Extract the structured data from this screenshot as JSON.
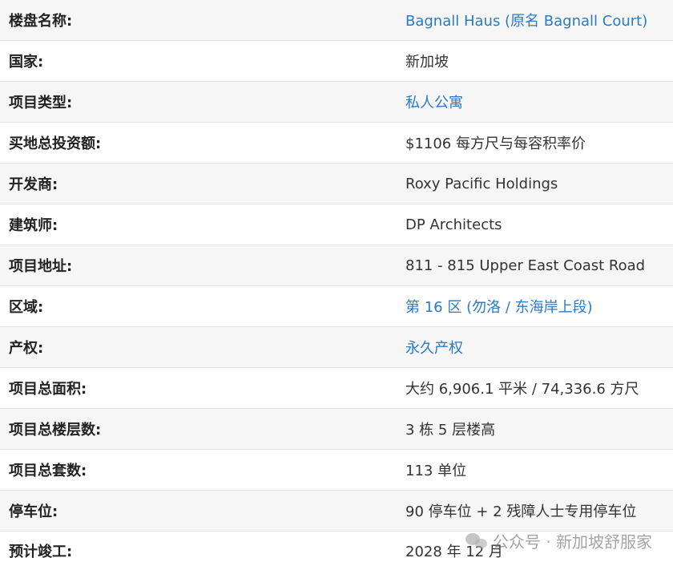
{
  "rows": [
    {
      "label": "楼盘名称:",
      "value": "Bagnall Haus (原名 Bagnall Court)",
      "link": true
    },
    {
      "label": "国家:",
      "value": "新加坡",
      "link": false
    },
    {
      "label": "项目类型:",
      "value": "私人公寓",
      "link": true
    },
    {
      "label": "买地总投资额:",
      "value": "$1106 每方尺与每容积率价",
      "link": false
    },
    {
      "label": "开发商:",
      "value": "Roxy Pacific Holdings",
      "link": false
    },
    {
      "label": "建筑师:",
      "value": "DP Architects",
      "link": false
    },
    {
      "label": "项目地址:",
      "value": "811 - 815 Upper East Coast Road",
      "link": false
    },
    {
      "label": "区域:",
      "value": "第 16 区 (勿洛 / 东海岸上段)",
      "link": true
    },
    {
      "label": "产权:",
      "value": "永久产权",
      "link": true
    },
    {
      "label": "项目总面积:",
      "value": "大约 6,906.1 平米 / 74,336.6 方尺",
      "link": false
    },
    {
      "label": "项目总楼层数:",
      "value": "3 栋 5 层楼高",
      "link": false
    },
    {
      "label": "项目总套数:",
      "value": "113 单位",
      "link": false
    },
    {
      "label": "停车位:",
      "value": "90 停车位 + 2 残障人士专用停车位",
      "link": false
    },
    {
      "label": "预计竣工:",
      "value": "2028 年 12 月",
      "link": false
    }
  ],
  "watermark": {
    "text": "公众号 · 新加坡舒服家",
    "icon": "wechat-icon"
  },
  "colors": {
    "link": "#2a7ac6",
    "stripe": "#f6f6f6",
    "border": "#e2e2e2"
  }
}
